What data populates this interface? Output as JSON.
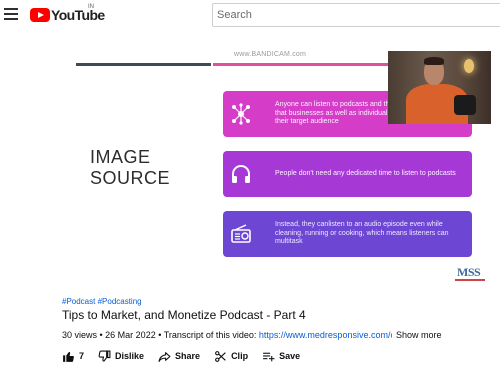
{
  "header": {
    "logo_text": "YouTube",
    "country_code": "IN",
    "search_placeholder": "Search"
  },
  "video": {
    "watermark": "www.BANDICAM.com",
    "slide_heading_line1": "IMAGE",
    "slide_heading_line2": "SOURCE",
    "cards": [
      {
        "icon": "network-icon",
        "text": "Anyone can listen to podcasts and that's the major reason that businesses as well as individuals use podcasts to reach their target audience"
      },
      {
        "icon": "headphones-icon",
        "text": "People don't need any dedicated time to listen to podcasts"
      },
      {
        "icon": "radio-icon",
        "text": "Instead, they canlisten to an audio episode even while cleaning, running or cooking, which means listeners can multitask"
      }
    ],
    "brand_mark": "MSS"
  },
  "details": {
    "hashtags": "#Podcast #Podcasting",
    "title": "Tips to Market, and Monetize Podcast - Part 4",
    "meta_prefix": "30 views • 26 Mar 2022 • Transcript of this video: ",
    "meta_link": "https://www.medresponsive.com/co",
    "show_more": "Show more"
  },
  "actions": {
    "like_count": "7",
    "dislike_label": "Dislike",
    "share_label": "Share",
    "clip_label": "Clip",
    "save_label": "Save"
  },
  "colors": {
    "youtube_red": "#ff0000",
    "card1": "#d53cc8",
    "card2": "#a638d6",
    "card3": "#6d46d4",
    "link_blue": "#065fd4"
  }
}
